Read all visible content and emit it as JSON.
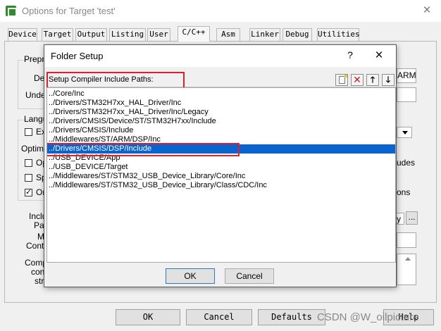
{
  "main": {
    "title": "Options for Target 'test'",
    "close": "×",
    "tabs": [
      "Device",
      "Target",
      "Output",
      "Listing",
      "User",
      "C/C++",
      "Asm",
      "Linker",
      "Debug",
      "Utilities"
    ],
    "active_tab": "C/C++",
    "fragments": {
      "prepro": "Prepro",
      "def": "Def",
      "undef": "Undef",
      "arm": "ARM",
      "langu": "Langu",
      "ex": "Ex",
      "optim": "Optim",
      "op": "Op",
      "sp": "Sp",
      "on": "On",
      "udes": "udes",
      "ons": "ons",
      "inclu": "Inclu",
      "path": "Path",
      "m": "M",
      "contr": "Contr",
      "comp": "Comp",
      "cont": "cont",
      "stri": "stri",
      "y": "y",
      "ellipsis": "..."
    },
    "buttons": {
      "ok": "OK",
      "cancel": "Cancel",
      "defaults": "Defaults",
      "help": "Help"
    }
  },
  "dialog": {
    "title": "Folder Setup",
    "help": "?",
    "close": "×",
    "header_label": "Setup Compiler Include Paths:",
    "toolbar": {
      "delete": "✕",
      "up": "🡑",
      "down": "🡓"
    },
    "paths": [
      "../Core/Inc",
      "../Drivers/STM32H7xx_HAL_Driver/Inc",
      "../Drivers/STM32H7xx_HAL_Driver/Inc/Legacy",
      "../Drivers/CMSIS/Device/ST/STM32H7xx/Include",
      "../Drivers/CMSIS/Include",
      "../Middlewares/ST/ARM/DSP/Inc",
      "../Drivers/CMSIS/DSP/Include",
      "../USB_DEVICE/App",
      "../USB_DEVICE/Target",
      "../Middlewares/ST/STM32_USB_Device_Library/Core/Inc",
      "../Middlewares/ST/STM32_USB_Device_Library/Class/CDC/Inc"
    ],
    "selected_index": 6,
    "buttons": {
      "ok": "OK",
      "cancel": "Cancel"
    }
  },
  "watermark": "CSDN @W_oilpicture",
  "colors": {
    "selection": "#0a64d0",
    "highlight_box": "#e01e2d",
    "title_text": "#888888"
  }
}
